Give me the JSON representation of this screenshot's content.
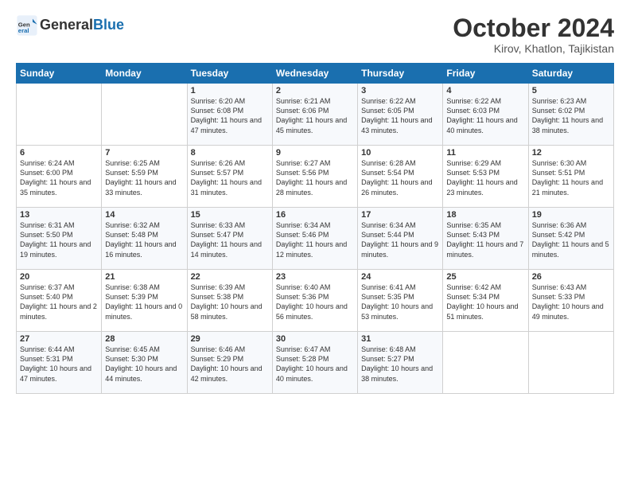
{
  "header": {
    "title": "October 2024",
    "location": "Kirov, Khatlon, Tajikistan",
    "logo_general": "General",
    "logo_blue": "Blue"
  },
  "columns": [
    "Sunday",
    "Monday",
    "Tuesday",
    "Wednesday",
    "Thursday",
    "Friday",
    "Saturday"
  ],
  "weeks": [
    [
      {
        "day": "",
        "sunrise": "",
        "sunset": "",
        "daylight": ""
      },
      {
        "day": "",
        "sunrise": "",
        "sunset": "",
        "daylight": ""
      },
      {
        "day": "1",
        "sunrise": "Sunrise: 6:20 AM",
        "sunset": "Sunset: 6:08 PM",
        "daylight": "Daylight: 11 hours and 47 minutes."
      },
      {
        "day": "2",
        "sunrise": "Sunrise: 6:21 AM",
        "sunset": "Sunset: 6:06 PM",
        "daylight": "Daylight: 11 hours and 45 minutes."
      },
      {
        "day": "3",
        "sunrise": "Sunrise: 6:22 AM",
        "sunset": "Sunset: 6:05 PM",
        "daylight": "Daylight: 11 hours and 43 minutes."
      },
      {
        "day": "4",
        "sunrise": "Sunrise: 6:22 AM",
        "sunset": "Sunset: 6:03 PM",
        "daylight": "Daylight: 11 hours and 40 minutes."
      },
      {
        "day": "5",
        "sunrise": "Sunrise: 6:23 AM",
        "sunset": "Sunset: 6:02 PM",
        "daylight": "Daylight: 11 hours and 38 minutes."
      }
    ],
    [
      {
        "day": "6",
        "sunrise": "Sunrise: 6:24 AM",
        "sunset": "Sunset: 6:00 PM",
        "daylight": "Daylight: 11 hours and 35 minutes."
      },
      {
        "day": "7",
        "sunrise": "Sunrise: 6:25 AM",
        "sunset": "Sunset: 5:59 PM",
        "daylight": "Daylight: 11 hours and 33 minutes."
      },
      {
        "day": "8",
        "sunrise": "Sunrise: 6:26 AM",
        "sunset": "Sunset: 5:57 PM",
        "daylight": "Daylight: 11 hours and 31 minutes."
      },
      {
        "day": "9",
        "sunrise": "Sunrise: 6:27 AM",
        "sunset": "Sunset: 5:56 PM",
        "daylight": "Daylight: 11 hours and 28 minutes."
      },
      {
        "day": "10",
        "sunrise": "Sunrise: 6:28 AM",
        "sunset": "Sunset: 5:54 PM",
        "daylight": "Daylight: 11 hours and 26 minutes."
      },
      {
        "day": "11",
        "sunrise": "Sunrise: 6:29 AM",
        "sunset": "Sunset: 5:53 PM",
        "daylight": "Daylight: 11 hours and 23 minutes."
      },
      {
        "day": "12",
        "sunrise": "Sunrise: 6:30 AM",
        "sunset": "Sunset: 5:51 PM",
        "daylight": "Daylight: 11 hours and 21 minutes."
      }
    ],
    [
      {
        "day": "13",
        "sunrise": "Sunrise: 6:31 AM",
        "sunset": "Sunset: 5:50 PM",
        "daylight": "Daylight: 11 hours and 19 minutes."
      },
      {
        "day": "14",
        "sunrise": "Sunrise: 6:32 AM",
        "sunset": "Sunset: 5:48 PM",
        "daylight": "Daylight: 11 hours and 16 minutes."
      },
      {
        "day": "15",
        "sunrise": "Sunrise: 6:33 AM",
        "sunset": "Sunset: 5:47 PM",
        "daylight": "Daylight: 11 hours and 14 minutes."
      },
      {
        "day": "16",
        "sunrise": "Sunrise: 6:34 AM",
        "sunset": "Sunset: 5:46 PM",
        "daylight": "Daylight: 11 hours and 12 minutes."
      },
      {
        "day": "17",
        "sunrise": "Sunrise: 6:34 AM",
        "sunset": "Sunset: 5:44 PM",
        "daylight": "Daylight: 11 hours and 9 minutes."
      },
      {
        "day": "18",
        "sunrise": "Sunrise: 6:35 AM",
        "sunset": "Sunset: 5:43 PM",
        "daylight": "Daylight: 11 hours and 7 minutes."
      },
      {
        "day": "19",
        "sunrise": "Sunrise: 6:36 AM",
        "sunset": "Sunset: 5:42 PM",
        "daylight": "Daylight: 11 hours and 5 minutes."
      }
    ],
    [
      {
        "day": "20",
        "sunrise": "Sunrise: 6:37 AM",
        "sunset": "Sunset: 5:40 PM",
        "daylight": "Daylight: 11 hours and 2 minutes."
      },
      {
        "day": "21",
        "sunrise": "Sunrise: 6:38 AM",
        "sunset": "Sunset: 5:39 PM",
        "daylight": "Daylight: 11 hours and 0 minutes."
      },
      {
        "day": "22",
        "sunrise": "Sunrise: 6:39 AM",
        "sunset": "Sunset: 5:38 PM",
        "daylight": "Daylight: 10 hours and 58 minutes."
      },
      {
        "day": "23",
        "sunrise": "Sunrise: 6:40 AM",
        "sunset": "Sunset: 5:36 PM",
        "daylight": "Daylight: 10 hours and 56 minutes."
      },
      {
        "day": "24",
        "sunrise": "Sunrise: 6:41 AM",
        "sunset": "Sunset: 5:35 PM",
        "daylight": "Daylight: 10 hours and 53 minutes."
      },
      {
        "day": "25",
        "sunrise": "Sunrise: 6:42 AM",
        "sunset": "Sunset: 5:34 PM",
        "daylight": "Daylight: 10 hours and 51 minutes."
      },
      {
        "day": "26",
        "sunrise": "Sunrise: 6:43 AM",
        "sunset": "Sunset: 5:33 PM",
        "daylight": "Daylight: 10 hours and 49 minutes."
      }
    ],
    [
      {
        "day": "27",
        "sunrise": "Sunrise: 6:44 AM",
        "sunset": "Sunset: 5:31 PM",
        "daylight": "Daylight: 10 hours and 47 minutes."
      },
      {
        "day": "28",
        "sunrise": "Sunrise: 6:45 AM",
        "sunset": "Sunset: 5:30 PM",
        "daylight": "Daylight: 10 hours and 44 minutes."
      },
      {
        "day": "29",
        "sunrise": "Sunrise: 6:46 AM",
        "sunset": "Sunset: 5:29 PM",
        "daylight": "Daylight: 10 hours and 42 minutes."
      },
      {
        "day": "30",
        "sunrise": "Sunrise: 6:47 AM",
        "sunset": "Sunset: 5:28 PM",
        "daylight": "Daylight: 10 hours and 40 minutes."
      },
      {
        "day": "31",
        "sunrise": "Sunrise: 6:48 AM",
        "sunset": "Sunset: 5:27 PM",
        "daylight": "Daylight: 10 hours and 38 minutes."
      },
      {
        "day": "",
        "sunrise": "",
        "sunset": "",
        "daylight": ""
      },
      {
        "day": "",
        "sunrise": "",
        "sunset": "",
        "daylight": ""
      }
    ]
  ]
}
